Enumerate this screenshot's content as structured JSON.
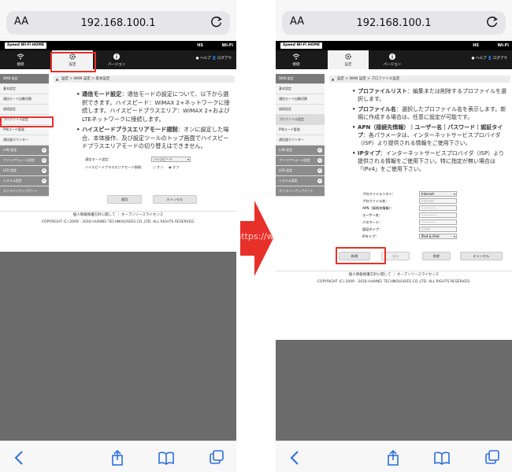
{
  "left": {
    "aa": "AA",
    "url": "192.168.100.1",
    "logo": "Speed Wi-Fi HOME",
    "hs": "HS",
    "wifi_badge": "Wi-Fi",
    "nav": [
      {
        "label": "接続",
        "icon": "wifi-icon"
      },
      {
        "label": "設定",
        "icon": "gear-icon"
      },
      {
        "label": "バージョン",
        "icon": "info-icon"
      }
    ],
    "help": "ヘルプ",
    "logout": "ログアウ",
    "sidebar": [
      {
        "label": "WAN 設定",
        "kind": "hdr"
      },
      {
        "label": "基本設定",
        "kind": "item"
      },
      {
        "label": "通信モード自動切替",
        "kind": "item"
      },
      {
        "label": "接続設定",
        "kind": "item"
      },
      {
        "label": "プロファイル設定",
        "kind": "item"
      },
      {
        "label": "PINコード管理",
        "kind": "item"
      },
      {
        "label": "通信量カウンター",
        "kind": "item"
      },
      {
        "label": "LAN 設定",
        "kind": "dark"
      },
      {
        "label": "ファイアウォール設定",
        "kind": "dark"
      },
      {
        "label": "LED 設定",
        "kind": "dark"
      },
      {
        "label": "システム設定",
        "kind": "dark"
      },
      {
        "label": "オンラインアップデート",
        "kind": "dark"
      }
    ],
    "crumb": "設定 > WAN 設定 > 基本設定",
    "bullets": [
      {
        "title": "通信モード設定",
        "text": "：通信モードの設定について、以下から選択できます。ハイスピード：WiMAX 2+ネットワークに接続します。ハイスピードプラスエリア：WiMAX 2+およびLTEネットワークに接続します。"
      },
      {
        "title": "ハイスピードプラスエリアモード規制",
        "text": "：オンに設定した場合、本体操作、及び設定ツールのトップ画面でハイスピードプラスエリアモードの切り替えはできません。"
      }
    ],
    "mode_label": "通信モード設定：",
    "mode_value": "ハイスピード",
    "restrict_label": "ハイスピードプラスエリアモード規制：",
    "radio_on": "オン",
    "radio_off": "オフ",
    "apply": "適用",
    "cancel": "キャンセル",
    "footer_links": "個人情報保護方針に関して ｜ オープンソースライセンス",
    "copyright": "COPYRIGHT (C) 2009 - 2018 HUAWEI TECHNOLOGIES CO.,LTD. ALL RIGHTS RESERVED."
  },
  "right": {
    "aa": "AA",
    "url": "192.168.100.1",
    "crumb": "設定 > WAN 設定 > プロファイル設定",
    "bullets": [
      {
        "title": "プロファイルリスト",
        "text": "：編集または削除するプロファイルを選択します。"
      },
      {
        "title": "プロファイル名",
        "text": "：選択したプロファイル名を表示します。新規に作成する場合は、任意に設定が可能です。"
      },
      {
        "title": "APN（接続先情報）｜ユーザー名｜パスワード｜認証タイプ",
        "text": "：各パラメータは、インターネットサービスプロバイダ（ISP）より提供される情報をご使用下さい。"
      },
      {
        "title": "IPタイプ",
        "text": "：インターネットサービスプロバイダ（ISP）より提供される情報をご使用下さい。特に指定が無い場合は「IPv4」をご使用下さい。"
      }
    ],
    "fields": [
      {
        "label": "プロファイルリスト：",
        "value": "Internet",
        "kind": "sel"
      },
      {
        "label": "プロファイル名：",
        "value": "Internet",
        "kind": "dis"
      },
      {
        "label": "APN（接続先情報）：",
        "value": "••••••••",
        "kind": "dis"
      },
      {
        "label": "ユーザー名：",
        "value": "••••••••",
        "kind": "dis"
      },
      {
        "label": "パスワード：",
        "value": "••••••••",
        "kind": "dis"
      },
      {
        "label": "認証タイプ：",
        "value": "CHAP",
        "kind": "dis"
      },
      {
        "label": "IPタイプ：",
        "value": "IPv4 & IPv6",
        "kind": "sel"
      }
    ],
    "btn_new": "新規",
    "btn_save": "保存",
    "btn_delete": "削除",
    "btn_cancel": "キャンセル",
    "footer_links": "個人情報保護方針に関して ｜ オープンソースライセンス",
    "copyright": "COPYRIGHT (C) 2009 - 2018 HUAWEI TECHNOLOGIES CO.,LTD. ALL RIGHTS RESERVED."
  },
  "watermark": "©Wi-Fiの森 https://wifinomori.com",
  "colors": {
    "highlight": "#e8302a",
    "arrow": "#e8302a"
  }
}
